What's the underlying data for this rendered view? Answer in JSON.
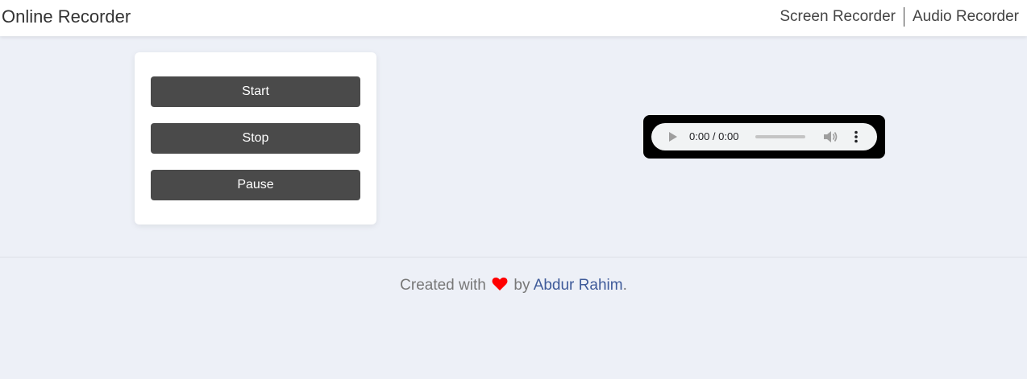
{
  "header": {
    "brand": "Online Recorder",
    "nav": [
      {
        "label": "Screen Recorder"
      },
      {
        "label": "Audio Recorder"
      }
    ]
  },
  "controls": {
    "start_label": "Start",
    "stop_label": "Stop",
    "pause_label": "Pause"
  },
  "player": {
    "time": "0:00 / 0:00",
    "icons": [
      "play-icon",
      "volume-icon",
      "more-options-icon"
    ]
  },
  "footer": {
    "prefix": "Created with",
    "by": "by",
    "author": "Abdur Rahim",
    "suffix": ".",
    "heart_color": "#ff0000",
    "link_color": "#3f5b9a"
  },
  "colors": {
    "background": "#edf0f7",
    "button": "#4a4a4a",
    "player_frame": "#000000"
  }
}
